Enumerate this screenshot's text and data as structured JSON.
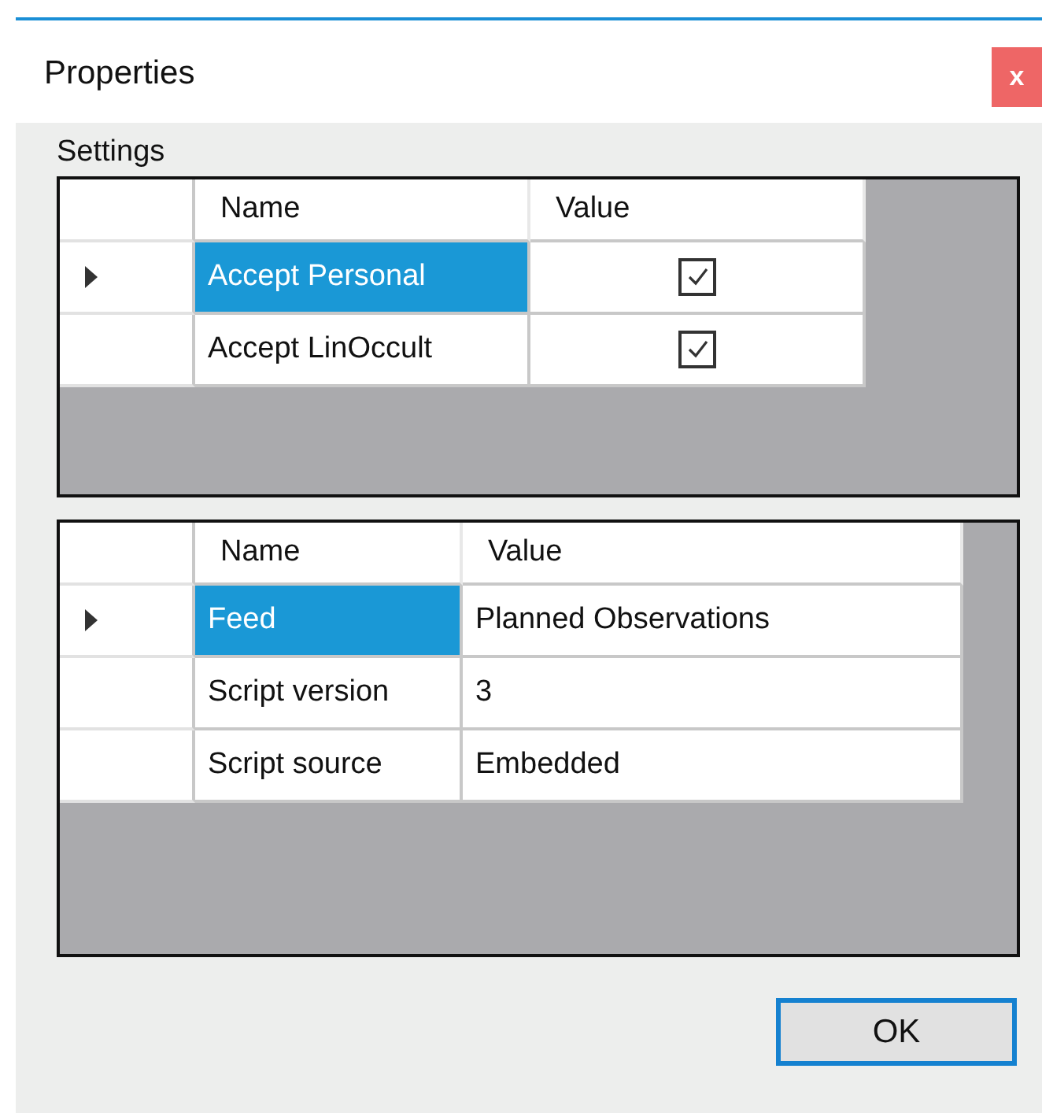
{
  "window": {
    "title": "Properties",
    "close": "x"
  },
  "group_label": "Settings",
  "grids": [
    {
      "columns": [
        "Name",
        "Value"
      ],
      "rows": [
        {
          "selected": true,
          "name": "Accept Personal",
          "value": {
            "kind": "check",
            "checked": true
          }
        },
        {
          "selected": false,
          "name": "Accept LinOccult",
          "value": {
            "kind": "check",
            "checked": true
          }
        }
      ]
    },
    {
      "columns": [
        "Name",
        "Value"
      ],
      "rows": [
        {
          "selected": true,
          "name": "Feed",
          "value": {
            "kind": "text",
            "text": "Planned Observations"
          }
        },
        {
          "selected": false,
          "name": "Script version",
          "value": {
            "kind": "text",
            "text": "3"
          }
        },
        {
          "selected": false,
          "name": "Script source",
          "value": {
            "kind": "text",
            "text": "Embedded"
          }
        }
      ]
    }
  ],
  "buttons": [
    "OK"
  ]
}
